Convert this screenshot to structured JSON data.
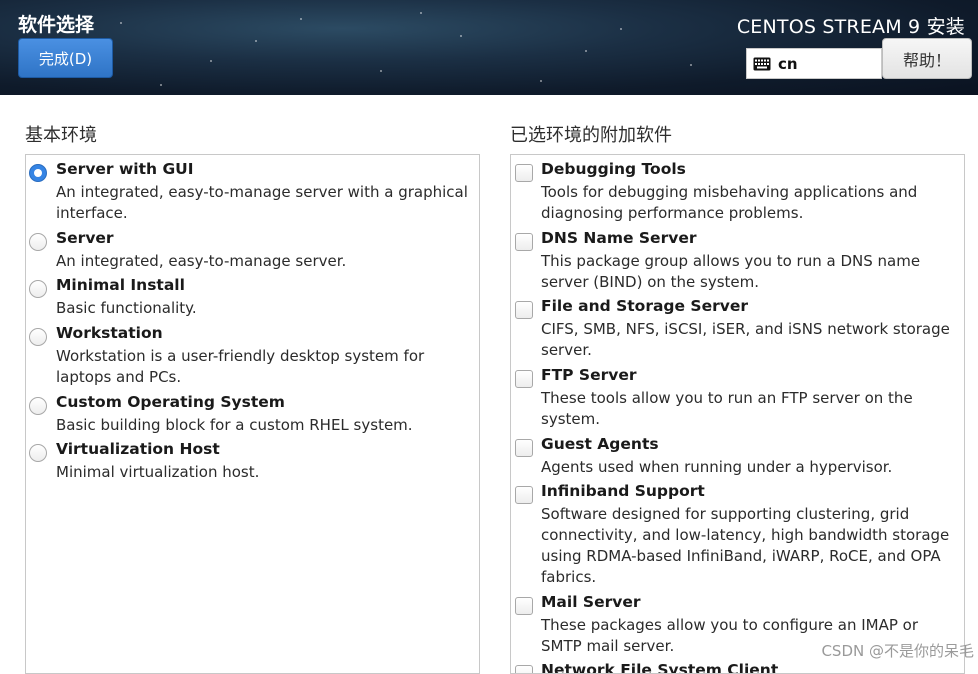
{
  "header": {
    "page_title": "软件选择",
    "done_button": "完成(D)",
    "product_title": "CENTOS STREAM 9 安装",
    "keyboard_layout": "cn",
    "help_button": "帮助！"
  },
  "base_environment": {
    "heading": "基本环境",
    "items": [
      {
        "title": "Server with GUI",
        "desc": "An integrated, easy-to-manage server with a graphical interface.",
        "selected": true
      },
      {
        "title": "Server",
        "desc": "An integrated, easy-to-manage server.",
        "selected": false
      },
      {
        "title": "Minimal Install",
        "desc": "Basic functionality.",
        "selected": false
      },
      {
        "title": "Workstation",
        "desc": "Workstation is a user-friendly desktop system for laptops and PCs.",
        "selected": false
      },
      {
        "title": "Custom Operating System",
        "desc": "Basic building block for a custom RHEL system.",
        "selected": false
      },
      {
        "title": "Virtualization Host",
        "desc": "Minimal virtualization host.",
        "selected": false
      }
    ]
  },
  "additional_software": {
    "heading": "已选环境的附加软件",
    "items": [
      {
        "title": "Debugging Tools",
        "desc": "Tools for debugging misbehaving applications and diagnosing performance problems.",
        "checked": false
      },
      {
        "title": "DNS Name Server",
        "desc": "This package group allows you to run a DNS name server (BIND) on the system.",
        "checked": false
      },
      {
        "title": "File and Storage Server",
        "desc": "CIFS, SMB, NFS, iSCSI, iSER, and iSNS network storage server.",
        "checked": false
      },
      {
        "title": "FTP Server",
        "desc": "These tools allow you to run an FTP server on the system.",
        "checked": false
      },
      {
        "title": "Guest Agents",
        "desc": "Agents used when running under a hypervisor.",
        "checked": false
      },
      {
        "title": "Infiniband Support",
        "desc": "Software designed for supporting clustering, grid connectivity, and low-latency, high bandwidth storage using RDMA-based InfiniBand, iWARP, RoCE, and OPA fabrics.",
        "checked": false
      },
      {
        "title": "Mail Server",
        "desc": "These packages allow you to configure an IMAP or SMTP mail server.",
        "checked": false
      },
      {
        "title": "Network File System Client",
        "desc": "",
        "checked": false
      }
    ]
  },
  "watermark": "CSDN @不是你的呆毛",
  "colors": {
    "accent": "#3584e4",
    "header_bg": "#1b2f44"
  },
  "icons": {
    "keyboard": "keyboard-icon",
    "radio": "radio-button",
    "checkbox": "checkbox"
  }
}
